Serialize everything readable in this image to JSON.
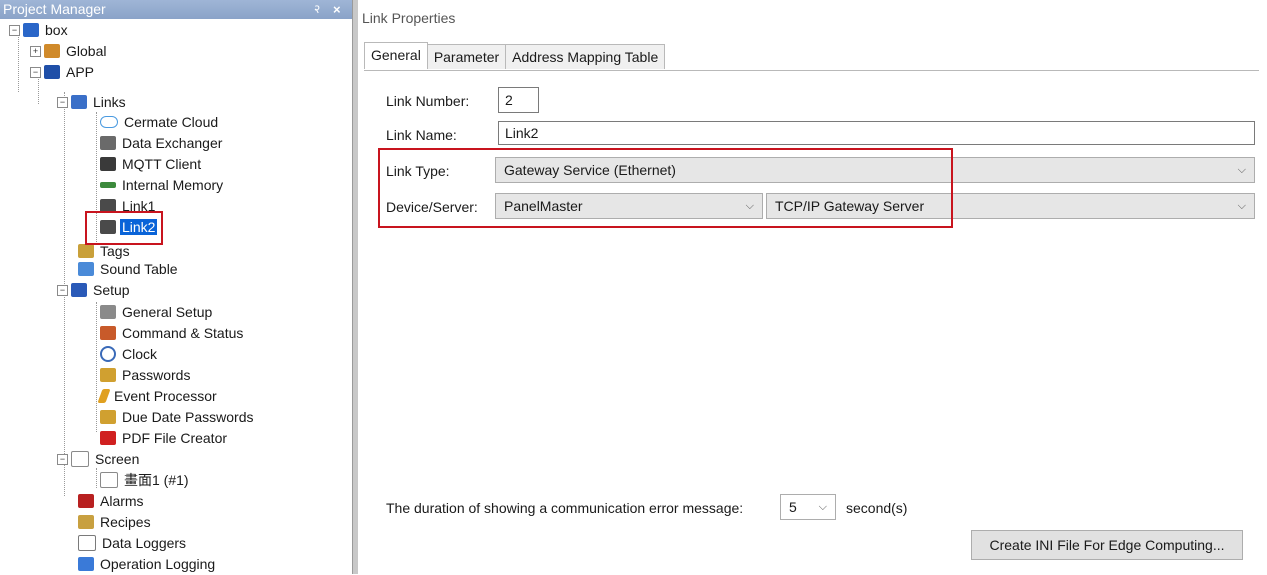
{
  "left_panel": {
    "title": "Project Manager",
    "pin_glyph": "२",
    "close_glyph": "×",
    "tree": [
      {
        "label": "box",
        "icon": "box-icon",
        "color": "#2a66c8"
      },
      {
        "label": "Global",
        "icon": "global-icon",
        "color": "#d08a2a"
      },
      {
        "label": "APP",
        "icon": "app-icon",
        "color": "#1f4fa8"
      },
      {
        "label": "Links",
        "icon": "links-icon",
        "color": "#3a6fc8"
      },
      {
        "label": "Cermate Cloud",
        "icon": "cloud-icon",
        "color": "#4a9ae0"
      },
      {
        "label": "Data Exchanger",
        "icon": "data-exchanger-icon",
        "color": "#6a6a6a"
      },
      {
        "label": "MQTT Client",
        "icon": "mqtt-client-icon",
        "color": "#3a3a3a"
      },
      {
        "label": "Internal Memory",
        "icon": "internal-memory-icon",
        "color": "#3c8a3c"
      },
      {
        "label": "Link1",
        "icon": "link1-icon",
        "color": "#4a4a4a"
      },
      {
        "label": "Link2",
        "icon": "link2-icon",
        "color": "#4a4a4a"
      },
      {
        "label": "Tags",
        "icon": "tags-icon",
        "color": "#c9a03a"
      },
      {
        "label": "Sound Table",
        "icon": "sound-table-icon",
        "color": "#4a8ad8"
      },
      {
        "label": "Setup",
        "icon": "setup-icon",
        "color": "#2a5ab8"
      },
      {
        "label": "General Setup",
        "icon": "general-setup-icon",
        "color": "#8a8a8a"
      },
      {
        "label": "Command & Status",
        "icon": "command-status-icon",
        "color": "#c85a2a"
      },
      {
        "label": "Clock",
        "icon": "clock-icon",
        "color": "#3a6ab8"
      },
      {
        "label": "Passwords",
        "icon": "passwords-icon",
        "color": "#d0a030"
      },
      {
        "label": "Event Processor",
        "icon": "event-processor-icon",
        "color": "#e0a020"
      },
      {
        "label": "Due Date Passwords",
        "icon": "due-date-passwords-icon",
        "color": "#d0a030"
      },
      {
        "label": "PDF File Creator",
        "icon": "pdf-file-creator-icon",
        "color": "#d02020"
      },
      {
        "label": "Screen",
        "icon": "screen-icon",
        "color": "#8a8a8a"
      },
      {
        "label": "畫面1 (#1)",
        "icon": "screen-page-icon",
        "color": "#8a8a8a"
      },
      {
        "label": "Alarms",
        "icon": "alarms-icon",
        "color": "#b82020"
      },
      {
        "label": "Recipes",
        "icon": "recipes-icon",
        "color": "#c8a040"
      },
      {
        "label": "Data Loggers",
        "icon": "data-loggers-icon",
        "color": "#7a7a7a"
      },
      {
        "label": "Operation Logging",
        "icon": "operation-logging-icon",
        "color": "#3a7ad8"
      }
    ]
  },
  "right_panel": {
    "title": "Link Properties",
    "tabs": [
      "General",
      "Parameter",
      "Address Mapping Table"
    ],
    "link_number_label": "Link Number:",
    "link_number_value": "2",
    "link_name_label": "Link Name:",
    "link_name_value": "Link2",
    "link_type_label": "Link Type:",
    "link_type_value": "Gateway Service (Ethernet)",
    "device_server_label": "Device/Server:",
    "device_value": "PanelMaster",
    "server_value": "TCP/IP Gateway Server",
    "duration_label": "The duration of showing a communication error message:",
    "duration_value": "5",
    "duration_unit": "second(s)",
    "ini_button": "Create INI File For Edge Computing..."
  }
}
